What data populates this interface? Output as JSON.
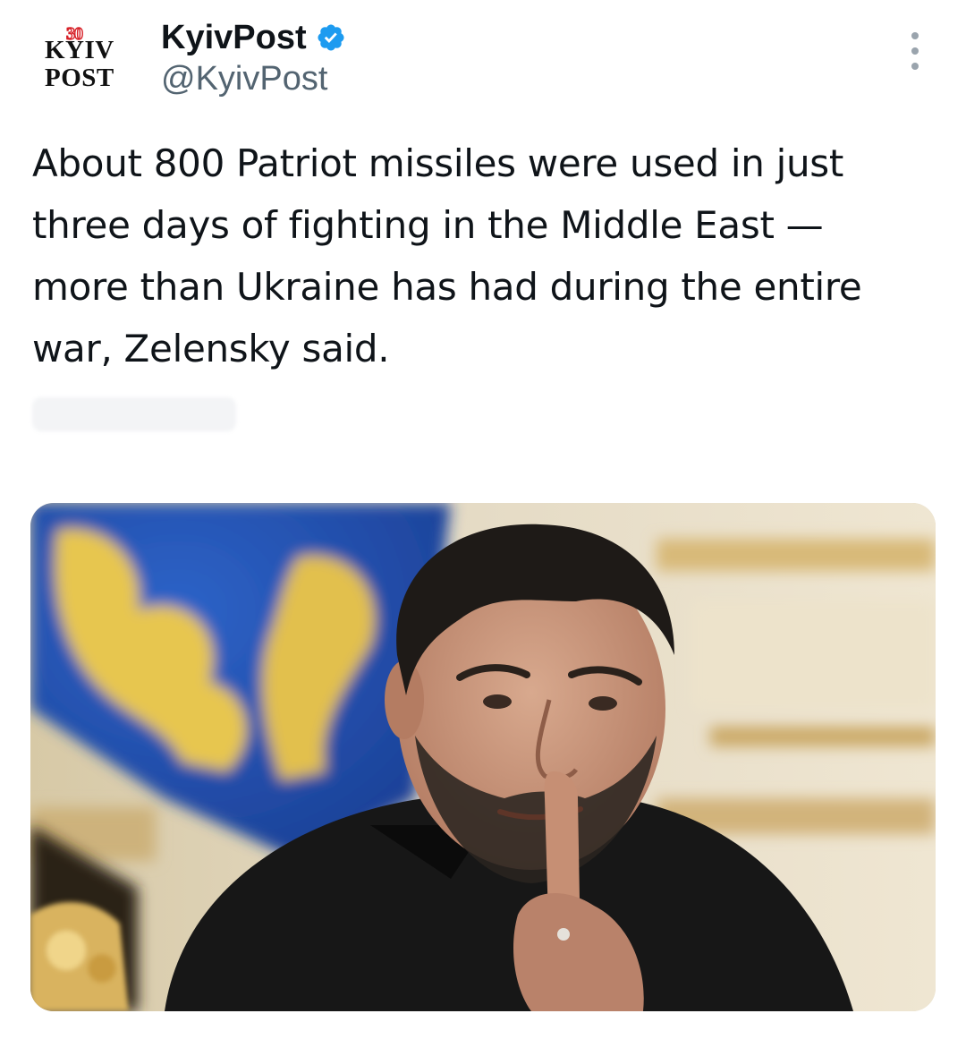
{
  "account": {
    "avatar": {
      "badge": "30",
      "line1": "KYIV",
      "line2": "POST"
    },
    "display_name": "KyivPost",
    "handle": "@KyivPost",
    "verified": true,
    "verified_icon": "verified-badge-icon",
    "more_icon": "more-options-icon"
  },
  "tweet": {
    "text": "About 800 Patriot missiles were used in just three days of fighting in the Middle East — more than Ukraine has had during the entire war, Zelensky said."
  },
  "media": {
    "type": "photo",
    "alt": ""
  },
  "colors": {
    "verified_blue": "#1d9bf0",
    "text_primary": "#0f1419",
    "text_secondary": "#536471",
    "logo_red": "#d72128"
  }
}
